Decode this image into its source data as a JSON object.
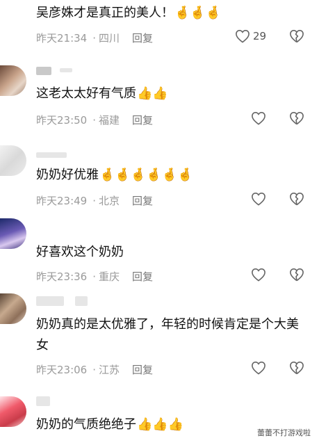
{
  "comments": [
    {
      "text": "吴彦姝才是真正的美人！",
      "emoji": "🤞🤞🤞",
      "time": "昨天21:34",
      "location": "四川",
      "reply": "回复",
      "likes": "29"
    },
    {
      "text": "这老太太好有气质",
      "emoji": "👍👍",
      "time": "昨天23:50",
      "location": "福建",
      "reply": "回复",
      "likes": ""
    },
    {
      "text": "奶奶好优雅",
      "emoji": "🤞🤞🤞🤞🤞🤞",
      "time": "昨天23:49",
      "location": "北京",
      "reply": "回复",
      "likes": ""
    },
    {
      "text": "好喜欢这个奶奶",
      "emoji": "",
      "time": "昨天23:36",
      "location": "重庆",
      "reply": "回复",
      "likes": ""
    },
    {
      "text": "奶奶真的是太优雅了，年轻的时候肯定是个大美女",
      "emoji": "",
      "time": "昨天23:06",
      "location": "江苏",
      "reply": "回复",
      "likes": ""
    },
    {
      "text": "奶奶的气质绝绝子",
      "emoji": "👍👍👍",
      "time": "",
      "location": "",
      "reply": "",
      "likes": ""
    }
  ],
  "watermark": "蕾蕾不打游戏啦",
  "icons": {
    "like": "heart-icon",
    "dislike": "broken-heart-icon"
  },
  "colors": {
    "meta": "#9a9a9a",
    "text": "#111111"
  }
}
